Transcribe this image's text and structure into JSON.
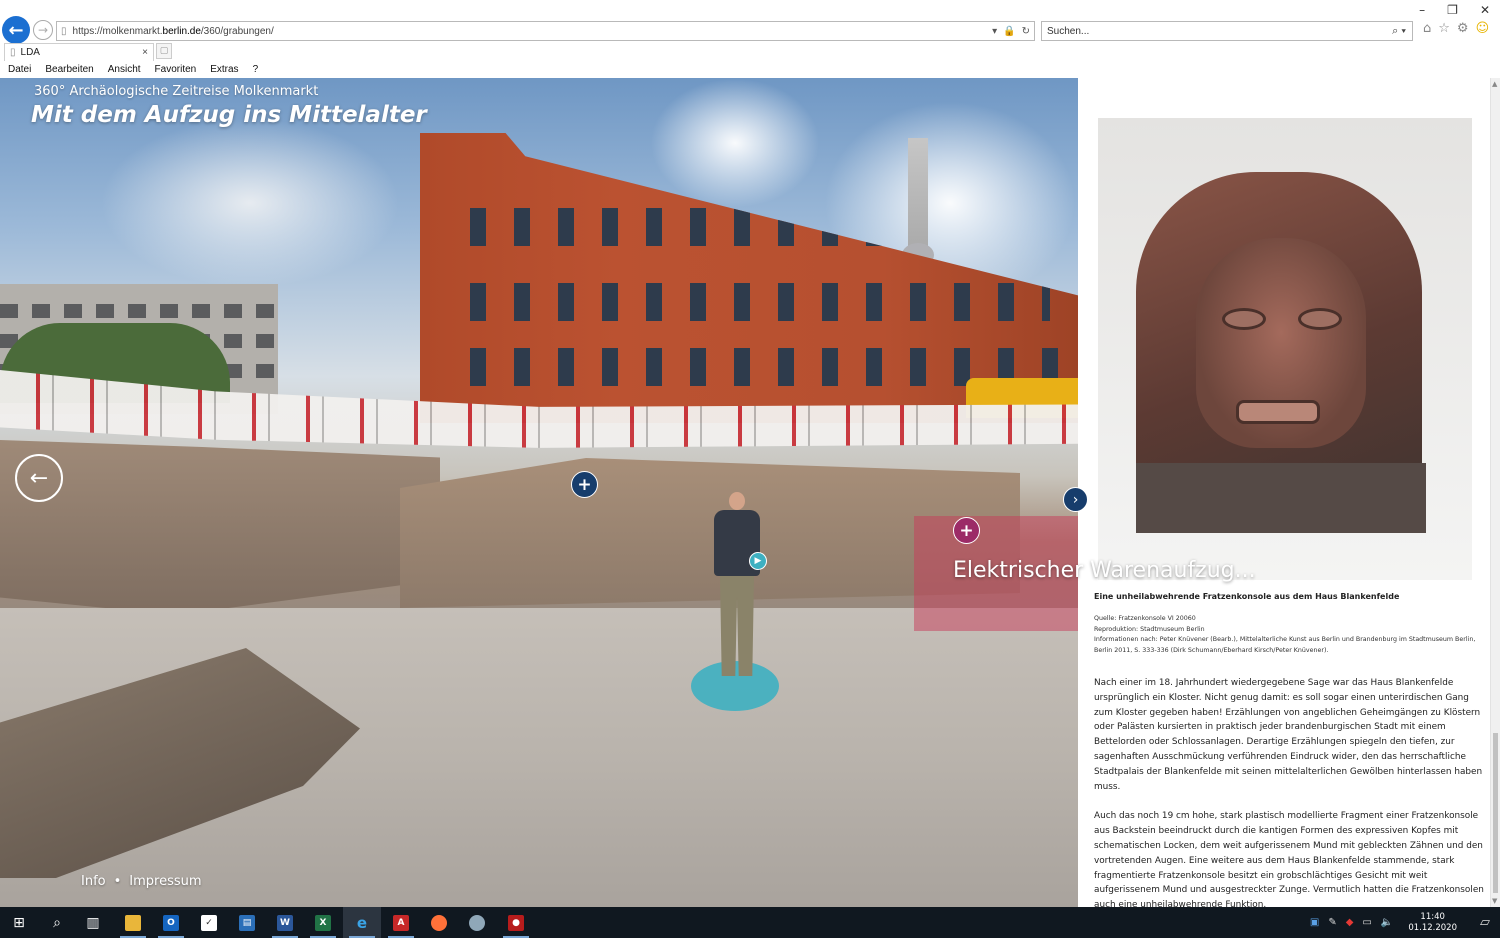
{
  "browser": {
    "url_prefix": "https://molkenmarkt.",
    "url_domain": "berlin.de",
    "url_path": "/360/grabungen/",
    "search_placeholder": "Suchen...",
    "tab_title": "LDA",
    "tab_close": "×",
    "menu": [
      "Datei",
      "Bearbeiten",
      "Ansicht",
      "Favoriten",
      "Extras",
      "?"
    ],
    "window_controls": [
      "–",
      "❐",
      "✕"
    ]
  },
  "viewer": {
    "subtitle": "360° Archäologische Zeitreise Molkenmarkt",
    "title": "Mit dem Aufzug ins Mittelalter",
    "hotspot_label": "Elektrischer Warenaufzug...",
    "footer": {
      "info": "Info",
      "separator": "•",
      "impressum": "Impressum"
    },
    "icons": {
      "prev": "arrow-left-icon",
      "next": "chevron-right-icon",
      "hotspot": "plus-icon",
      "play": "play-icon"
    }
  },
  "info_panel": {
    "caption": "Eine unheilabwehrende Fratzenkonsole aus dem Haus Blankenfelde",
    "source": [
      "Quelle: Fratzenkonsole VI 20060",
      "Reproduktion: Stadtmuseum Berlin",
      "Informationen nach: Peter Knüvener (Bearb.), Mittelalterliche Kunst aus Berlin und Brandenburg im Stadtmuseum Berlin,",
      "Berlin 2011, S. 333-336 (Dirk Schumann/Eberhard Kirsch/Peter Knüvener)."
    ],
    "paragraphs": [
      "Nach einer im 18. Jahrhundert wiedergegebene Sage war das Haus Blankenfelde ursprünglich ein Kloster. Nicht genug damit: es soll sogar einen unterirdischen Gang zum Kloster gegeben haben! Erzählungen von angeblichen Geheimgängen zu Klöstern oder Palästen kursierten in praktisch jeder brandenburgischen Stadt mit einem Bettelorden oder Schlossanlagen. Derartige Erzählungen spiegeln den tiefen, zur sagenhaften Ausschmückung verführenden Eindruck wider, den das herrschaftliche Stadtpalais der Blankenfelde mit seinen mittelalterlichen Gewölben hinterlassen haben muss.",
      "Auch das noch 19 cm hohe, stark plastisch modellierte Fragment einer Fratzenkonsole aus Backstein beeindruckt durch die kantigen Formen des expressiven Kopfes mit schematischen Locken, dem weit aufgerissenem Mund mit gebleckten Zähnen und den vortretenden Augen. Eine weitere aus dem Haus Blankenfelde stammende, stark fragmentierte Fratzenkonsole besitzt ein grobschlächtiges Gesicht mit weit aufgerissenem Mund und ausgestreckter Zunge. Vermutlich hatten die Fratzenkonsolen auch eine unheilabwehrende Funktion."
    ]
  },
  "taskbar": {
    "time": "11:40",
    "date": "01.12.2020",
    "apps": [
      "start-icon",
      "search-icon",
      "task-view-icon",
      "file-explorer-icon",
      "outlook-icon",
      "tasks-icon",
      "document-icon",
      "word-icon",
      "excel-icon",
      "internet-explorer-icon",
      "acrobat-icon",
      "firefox-icon",
      "app-icon",
      "media-icon"
    ]
  },
  "colors": {
    "hotspot_blue": "#173d6c",
    "hotspot_magenta": "#9c2b67",
    "guide_teal": "#3eb0c1",
    "taskbar": "#101820"
  }
}
